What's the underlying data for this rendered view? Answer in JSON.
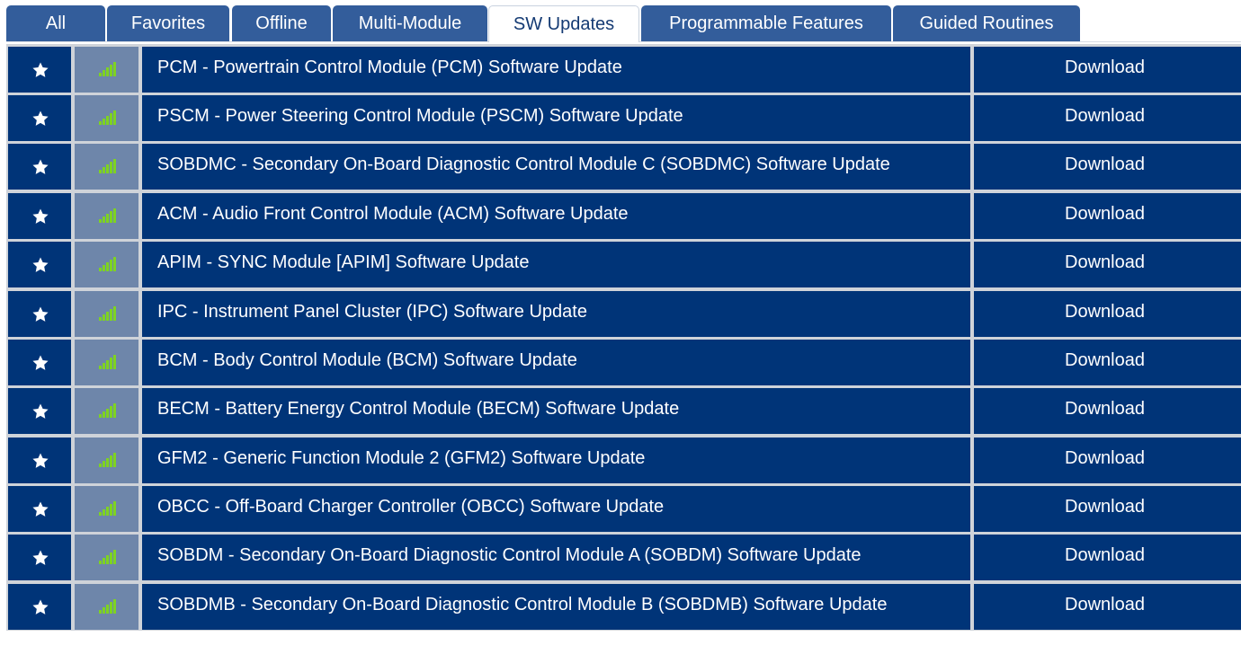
{
  "tabs": [
    {
      "label": "All",
      "active": false
    },
    {
      "label": "Favorites",
      "active": false
    },
    {
      "label": "Offline",
      "active": false
    },
    {
      "label": "Multi-Module",
      "active": false
    },
    {
      "label": "SW Updates",
      "active": true
    },
    {
      "label": "Programmable Features",
      "active": false
    },
    {
      "label": "Guided Routines",
      "active": false
    }
  ],
  "rows": [
    {
      "name": "PCM - Powertrain Control Module (PCM) Software Update",
      "action": "Download"
    },
    {
      "name": "PSCM - Power Steering Control Module (PSCM) Software Update",
      "action": "Download"
    },
    {
      "name": "SOBDMC - Secondary On-Board Diagnostic Control Module C (SOBDMC) Software Update",
      "action": "Download"
    },
    {
      "name": "ACM - Audio Front Control Module (ACM) Software Update",
      "action": "Download"
    },
    {
      "name": "APIM - SYNC Module [APIM] Software Update",
      "action": "Download"
    },
    {
      "name": "IPC - Instrument Panel Cluster (IPC) Software Update",
      "action": "Download"
    },
    {
      "name": "BCM - Body Control Module (BCM) Software Update",
      "action": "Download"
    },
    {
      "name": "BECM - Battery Energy Control Module (BECM) Software Update",
      "action": "Download"
    },
    {
      "name": "GFM2 - Generic Function Module 2 (GFM2) Software Update",
      "action": "Download"
    },
    {
      "name": "OBCC - Off-Board Charger Controller (OBCC) Software Update",
      "action": "Download"
    },
    {
      "name": "SOBDM - Secondary On-Board Diagnostic Control Module A (SOBDM) Software Update",
      "action": "Download"
    },
    {
      "name": "SOBDMB - Secondary On-Board Diagnostic Control Module B (SOBDMB) Software Update",
      "action": "Download"
    }
  ],
  "icons": {
    "favorite": "star-icon",
    "status": "signal-strength-icon"
  },
  "colors": {
    "row_bg": "#003478",
    "signal_cell_bg": "#6e86aa",
    "signal_bars": "#7ed321",
    "tab_bg": "#335d9b",
    "active_tab_text": "#143a73"
  }
}
